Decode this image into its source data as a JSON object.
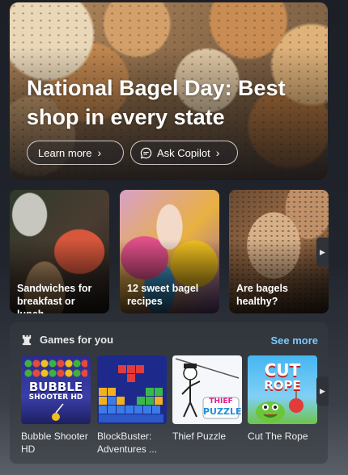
{
  "hero": {
    "title": "National Bagel Day: Best shop in every state",
    "learn_more": "Learn more",
    "ask_copilot": "Ask Copilot"
  },
  "cards": [
    {
      "caption": "Sandwiches for breakfast or lunch"
    },
    {
      "caption": "12 sweet bagel recipes"
    },
    {
      "caption": "Are bagels healthy?"
    }
  ],
  "games": {
    "title": "Games for you",
    "see_more": "See more",
    "items": [
      {
        "name": "Bubble Shooter HD",
        "tile_text": "BUBBLE",
        "tile_sub": "SHOOTER HD"
      },
      {
        "name": "BlockBuster: Adventures ...",
        "tile_text": "",
        "tile_sub": ""
      },
      {
        "name": "Thief Puzzle",
        "tile_text": "THIEF",
        "tile_sub": "PUZZLE"
      },
      {
        "name": "Cut The Rope",
        "tile_text": "CUT",
        "tile_sub": "ROPE"
      }
    ]
  },
  "colors": {
    "link": "#7cc8ff",
    "panel": "#2f3238"
  }
}
